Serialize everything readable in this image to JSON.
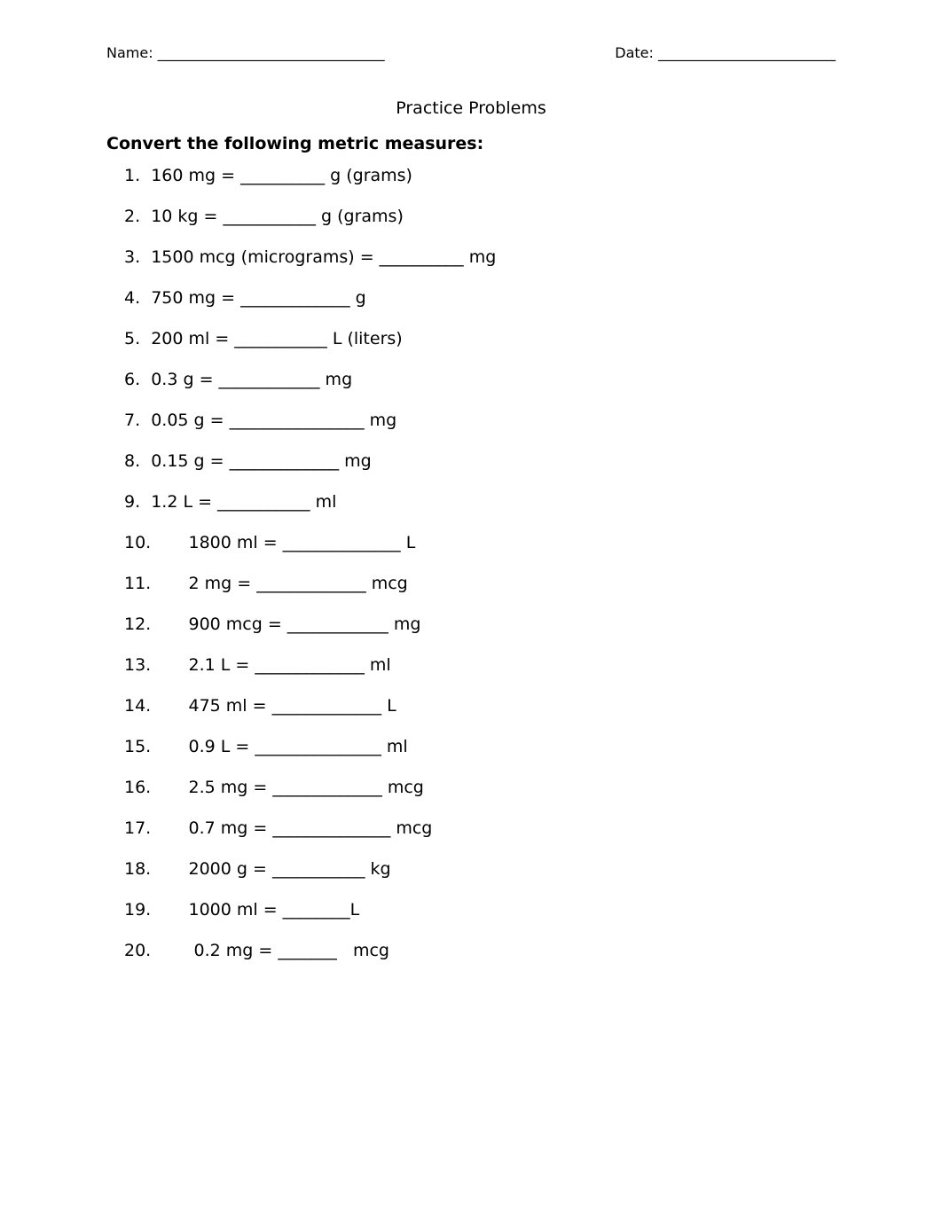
{
  "header": {
    "name_label": "Name: ________________________________",
    "date_label": "Date: _________________________"
  },
  "title": "Practice Problems",
  "directions": "Convert the following metric measures:",
  "problems": [
    "1.  160 mg = __________ g (grams)",
    "2.  10 kg = ___________ g (grams)",
    "3.  1500 mcg (micrograms) = __________ mg",
    "4.  750 mg = _____________ g",
    "5.  200 ml = ___________ L (liters)",
    "6.  0.3 g = ____________ mg",
    "7.  0.05 g = ________________ mg",
    "8.  0.15 g = _____________ mg",
    "9.  1.2 L = ___________ ml",
    "10.       1800 ml = ______________ L",
    "11.       2 mg = _____________ mcg",
    "12.       900 mcg = ____________ mg",
    "13.       2.1 L = _____________ ml",
    "14.       475 ml = _____________ L",
    "15.       0.9 L = _______________ ml",
    "16.       2.5 mg = _____________ mcg",
    "17.       0.7 mg = ______________ mcg",
    "18.       2000 g = ___________ kg",
    "19.       1000 ml = ________L",
    "20.        0.2 mg = _______   mcg"
  ]
}
